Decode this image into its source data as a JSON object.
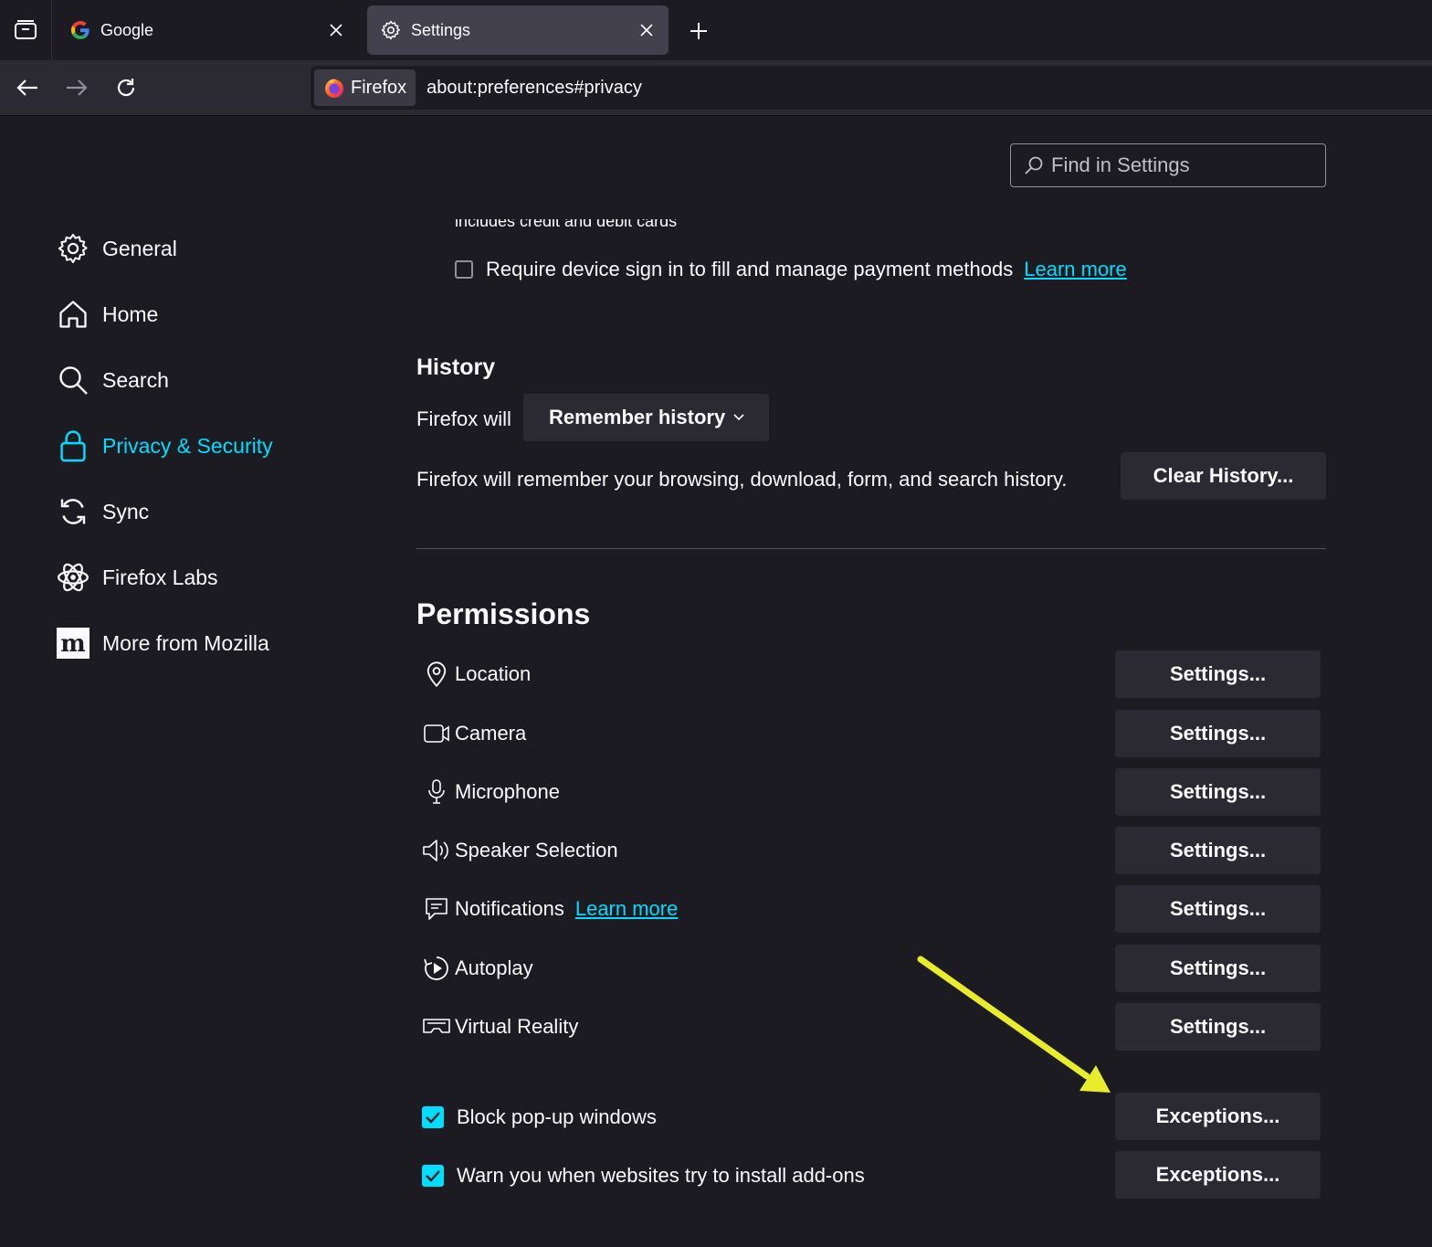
{
  "tabs": [
    {
      "title": "Google",
      "icon": "google-icon",
      "active": false
    },
    {
      "title": "Settings",
      "icon": "gear-icon",
      "active": true
    }
  ],
  "urlbar": {
    "identity_label": "Firefox",
    "url": "about:preferences#privacy"
  },
  "search": {
    "placeholder": "Find in Settings"
  },
  "sidebar": {
    "items": [
      {
        "label": "General",
        "icon": "gear-icon"
      },
      {
        "label": "Home",
        "icon": "home-icon"
      },
      {
        "label": "Search",
        "icon": "search-icon"
      },
      {
        "label": "Privacy & Security",
        "icon": "lock-icon",
        "selected": true
      },
      {
        "label": "Sync",
        "icon": "sync-icon"
      },
      {
        "label": "Firefox Labs",
        "icon": "labs-icon"
      },
      {
        "label": "More from Mozilla",
        "icon": "mozilla-icon"
      }
    ]
  },
  "payment": {
    "clipped_text": "includes credit and debit cards",
    "require_signin_label": "Require device sign in to fill and manage payment methods",
    "require_signin_checked": false,
    "learn_more": "Learn more"
  },
  "history": {
    "heading": "History",
    "firefox_will_label": "Firefox will",
    "mode": "Remember history",
    "description": "Firefox will remember your browsing, download, form, and search history.",
    "clear_button": "Clear History..."
  },
  "permissions": {
    "heading": "Permissions",
    "items": [
      {
        "label": "Location",
        "icon": "location-icon",
        "button": "Settings..."
      },
      {
        "label": "Camera",
        "icon": "camera-icon",
        "button": "Settings..."
      },
      {
        "label": "Microphone",
        "icon": "microphone-icon",
        "button": "Settings..."
      },
      {
        "label": "Speaker Selection",
        "icon": "speaker-icon",
        "button": "Settings..."
      },
      {
        "label": "Notifications",
        "icon": "notification-icon",
        "button": "Settings...",
        "link": "Learn more"
      },
      {
        "label": "Autoplay",
        "icon": "autoplay-icon",
        "button": "Settings..."
      },
      {
        "label": "Virtual Reality",
        "icon": "vr-icon",
        "button": "Settings..."
      }
    ],
    "block_popups_label": "Block pop-up windows",
    "block_popups_checked": true,
    "warn_addons_label": "Warn you when websites try to install add-ons",
    "warn_addons_checked": true,
    "exceptions_button": "Exceptions..."
  },
  "colors": {
    "background": "#1c1b22",
    "accent": "#00ddff",
    "button_bg": "#2b2a33",
    "annotation_arrow": "#e8ec2a"
  }
}
